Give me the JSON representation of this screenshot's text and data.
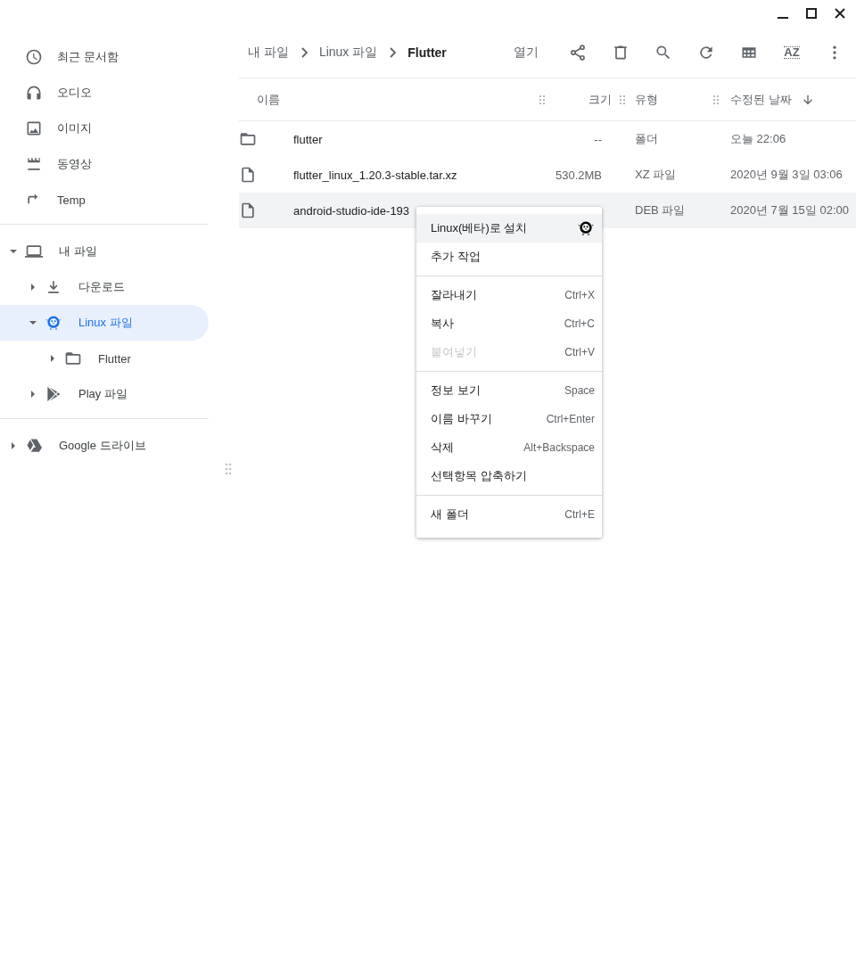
{
  "sidebar": {
    "places": [
      {
        "label": "최근 문서함",
        "kind": "recent"
      },
      {
        "label": "오디오",
        "kind": "audio"
      },
      {
        "label": "이미지",
        "kind": "image"
      },
      {
        "label": "동영상",
        "kind": "video"
      },
      {
        "label": "Temp",
        "kind": "shortcut"
      }
    ],
    "tree": [
      {
        "label": "내 파일",
        "kind": "computer",
        "expanded": true,
        "selected": false,
        "children": [
          {
            "label": "다운로드",
            "kind": "download",
            "expanded": false,
            "selected": false
          },
          {
            "label": "Linux 파일",
            "kind": "linux",
            "expanded": true,
            "selected": true,
            "children": [
              {
                "label": "Flutter",
                "kind": "folder",
                "expanded": false,
                "selected": false
              }
            ]
          },
          {
            "label": "Play 파일",
            "kind": "play",
            "expanded": false,
            "selected": false
          }
        ]
      }
    ],
    "drives": [
      {
        "label": "Google 드라이브",
        "kind": "drive",
        "expanded": false,
        "selected": false
      }
    ]
  },
  "breadcrumb": [
    {
      "label": "내 파일",
      "current": false
    },
    {
      "label": "Linux 파일",
      "current": false
    },
    {
      "label": "Flutter",
      "current": true
    }
  ],
  "toolbar": {
    "open_label": "열기",
    "sort_label": "AZ"
  },
  "table": {
    "columns": [
      "이름",
      "크기",
      "유형",
      "수정된 날짜"
    ],
    "rows": [
      {
        "kind": "folder",
        "name": "flutter",
        "size": "--",
        "type": "폴더",
        "modified": "오늘 22:06",
        "selected": false
      },
      {
        "kind": "file",
        "name": "flutter_linux_1.20.3-stable.tar.xz",
        "size": "530.2MB",
        "type": "XZ 파일",
        "modified": "2020년 9월 3일 03:06",
        "selected": false
      },
      {
        "kind": "file",
        "name": "android-studio-ide-193",
        "type": "DEB 파일",
        "modified": "2020년 7월 15일 02:00",
        "selected": true
      }
    ]
  },
  "context_menu": [
    [
      {
        "label": "Linux(베타)로 설치",
        "highlighted": true,
        "disabled": false,
        "kind": "linux"
      },
      {
        "label": "추가 작업",
        "highlighted": false,
        "disabled": false
      }
    ],
    [
      {
        "label": "잘라내기",
        "shortcut": "Ctrl+X",
        "highlighted": false,
        "disabled": false
      },
      {
        "label": "복사",
        "shortcut": "Ctrl+C",
        "highlighted": false,
        "disabled": false
      },
      {
        "label": "붙여넣기",
        "shortcut": "Ctrl+V",
        "highlighted": false,
        "disabled": true
      }
    ],
    [
      {
        "label": "정보 보기",
        "shortcut": "Space",
        "highlighted": false,
        "disabled": false
      },
      {
        "label": "이름 바꾸기",
        "shortcut": "Ctrl+Enter",
        "highlighted": false,
        "disabled": false
      },
      {
        "label": "삭제",
        "shortcut": "Alt+Backspace",
        "highlighted": false,
        "disabled": false
      },
      {
        "label": "선택항목 압축하기",
        "highlighted": false,
        "disabled": false
      }
    ],
    [
      {
        "label": "새 폴더",
        "shortcut": "Ctrl+E",
        "highlighted": false,
        "disabled": false
      }
    ]
  ]
}
